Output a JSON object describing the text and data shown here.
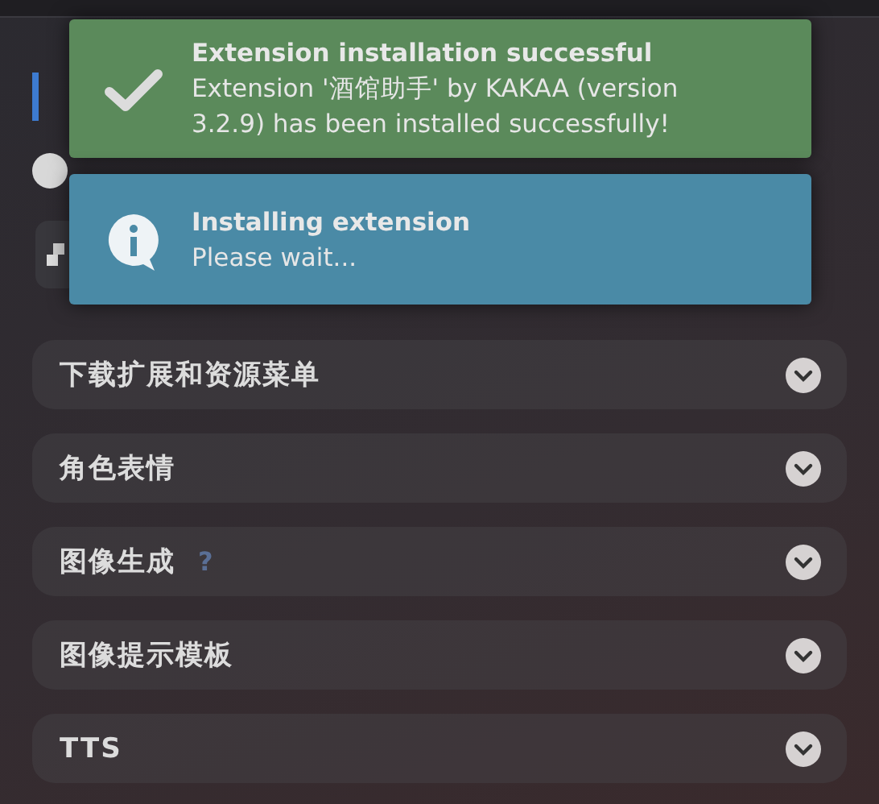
{
  "toasts": [
    {
      "kind": "success",
      "title": "Extension installation successful",
      "message": "Extension '酒馆助手' by KAKAA (version 3.2.9) has been installed successfully!"
    },
    {
      "kind": "info",
      "title": "Installing extension",
      "message": "Please wait..."
    }
  ],
  "sections": [
    {
      "title": "下载扩展和资源菜单",
      "expanded": false
    },
    {
      "title": "角色表情",
      "expanded": false
    },
    {
      "title": "图像生成",
      "help": "?",
      "expanded": false
    },
    {
      "title": "图像提示模板",
      "expanded": false
    },
    {
      "title": "TTS",
      "expanded": false
    }
  ]
}
